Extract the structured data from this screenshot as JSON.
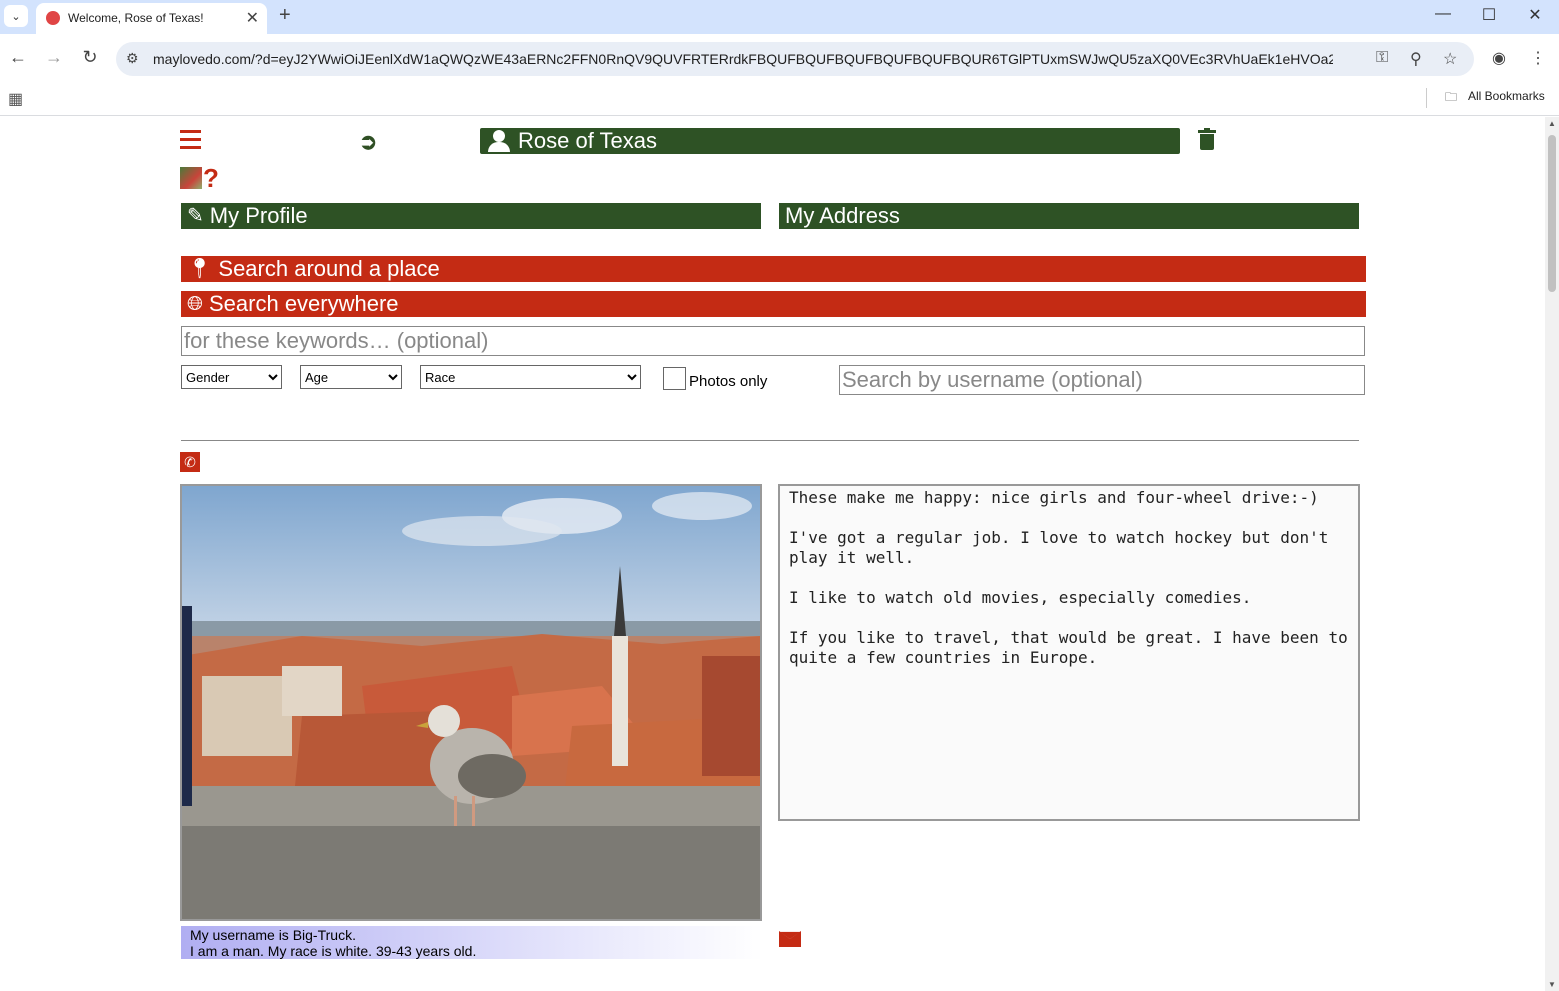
{
  "browser": {
    "tab_title": "Welcome, Rose of Texas!",
    "url": "maylovedo.com/?d=eyJ2YWwiOiJEenlXdW1aQWQzWE43aERNc2FFN0RnQV9QUVFRTERrdkFBQUFBQUFBQUFBQUFBQUFBQUR6TGlPTUxmSWJwQU5zaXQ0VEc3RVhUaEk1eHVOa2RfSlhtZWc2...",
    "bookmarks_label": "All Bookmarks"
  },
  "header": {
    "user_name": "Rose of Texas"
  },
  "buttons": {
    "my_profile": "My Profile",
    "my_address": "My Address",
    "search_around": "Search around a place",
    "search_everywhere": "Search everywhere"
  },
  "search": {
    "keywords_placeholder": "for these keywords… (optional)",
    "gender": "Gender",
    "age": "Age",
    "race": "Race",
    "photos_only": "Photos only",
    "username_placeholder": "Search by username (optional)"
  },
  "profile": {
    "about": "These make me happy: nice girls and four-wheel drive:-)\n\nI've got a regular job. I love to watch hockey but don't\nplay it well.\n\nI like to watch old movies, especially comedies.\n\nIf you like to travel, that would be great. I have been to\nquite a few countries in Europe.",
    "username_line": "My username is Big-Truck.",
    "details_line": "I am a man. My race is white. 39-43 years old."
  }
}
